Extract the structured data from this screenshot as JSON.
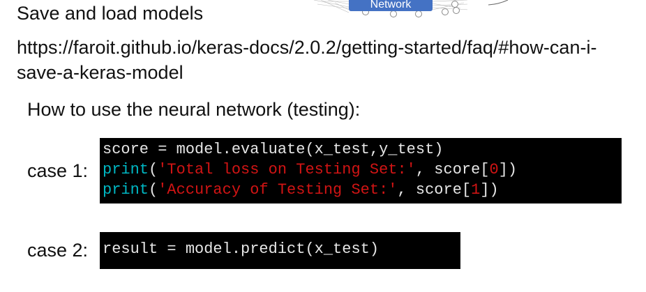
{
  "title": "Save and load models",
  "link": "https://faroit.github.io/keras-docs/2.0.2/getting-started/faq/#how-can-i-save-a-keras-model",
  "subheading": "How to use the neural network (testing):",
  "network_label": "Network",
  "case1": {
    "label": "case 1:",
    "line1": "score = model.evaluate(x_test,y_test)",
    "line2": {
      "fn": "print",
      "open": "(",
      "str": "'Total loss on Testing Set:'",
      "comma": ", score[",
      "idx": "0",
      "close": "])"
    },
    "line3": {
      "fn": "print",
      "open": "(",
      "str": "'Accuracy of Testing Set:'",
      "comma": ", score[",
      "idx": "1",
      "close": "])"
    }
  },
  "case2": {
    "label": "case 2:",
    "line1": "result = model.predict(x_test)"
  },
  "colors": {
    "code_bg": "#000000",
    "keyword": "#00b7c3",
    "string": "#d11414",
    "network_button": "#4472c4"
  }
}
